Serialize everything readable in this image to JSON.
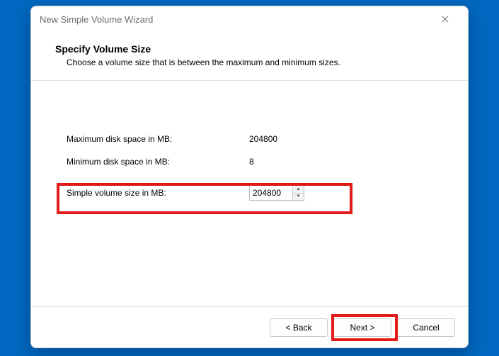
{
  "window": {
    "title": "New Simple Volume Wizard"
  },
  "header": {
    "title": "Specify Volume Size",
    "description": "Choose a volume size that is between the maximum and minimum sizes."
  },
  "fields": {
    "max_label": "Maximum disk space in MB:",
    "max_value": "204800",
    "min_label": "Minimum disk space in MB:",
    "min_value": "8",
    "size_label": "Simple volume size in MB:",
    "size_value": "204800"
  },
  "buttons": {
    "back": "< Back",
    "next": "Next >",
    "cancel": "Cancel"
  }
}
